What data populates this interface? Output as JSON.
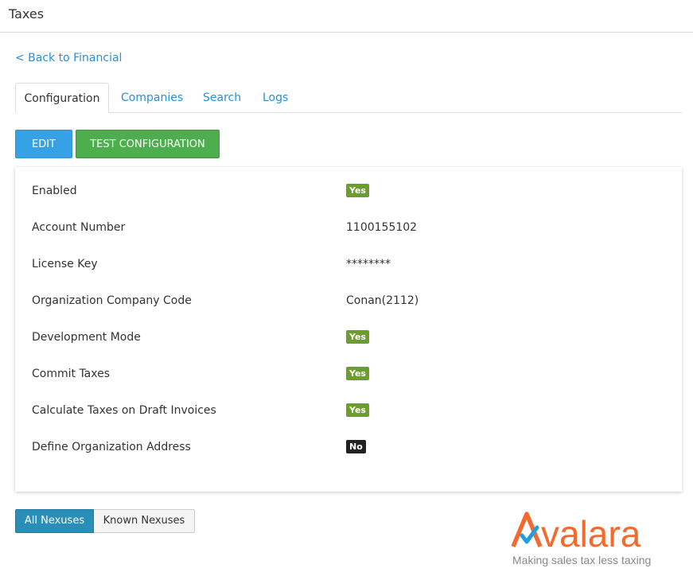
{
  "header": {
    "title": "Taxes"
  },
  "back_link": "< Back to Financial",
  "tabs": [
    {
      "label": "Configuration",
      "active": true
    },
    {
      "label": "Companies",
      "active": false
    },
    {
      "label": "Search",
      "active": false
    },
    {
      "label": "Logs",
      "active": false
    }
  ],
  "actions": {
    "edit_label": "EDIT",
    "test_label": "TEST CONFIGURATION"
  },
  "config": {
    "rows": [
      {
        "label": "Enabled",
        "value": "Yes",
        "kind": "badge-yes"
      },
      {
        "label": "Account Number",
        "value": "1100155102",
        "kind": "text"
      },
      {
        "label": "License Key",
        "value": "********",
        "kind": "text"
      },
      {
        "label": "Organization Company Code",
        "value": "Conan(2112)",
        "kind": "text"
      },
      {
        "label": "Development Mode",
        "value": "Yes",
        "kind": "badge-yes"
      },
      {
        "label": "Commit Taxes",
        "value": "Yes",
        "kind": "badge-yes"
      },
      {
        "label": "Calculate Taxes on Draft Invoices",
        "value": "Yes",
        "kind": "badge-yes"
      },
      {
        "label": "Define Organization Address",
        "value": "No",
        "kind": "badge-no"
      }
    ]
  },
  "nexus_toggle": {
    "all_label": "All Nexuses",
    "known_label": "Known Nexuses",
    "selected": "All Nexuses"
  },
  "logo": {
    "brand": "Avalara",
    "tagline": "Making sales tax less taxing"
  },
  "colors": {
    "link": "#2b8fd6",
    "edit_button": "#36a1e5",
    "test_button": "#4cae4c",
    "badge_yes": "#6c9e2e",
    "badge_no": "#222222",
    "toggle_active": "#2a8fb8",
    "brand_orange": "#f26a2e",
    "brand_check": "#1f9fdb"
  }
}
